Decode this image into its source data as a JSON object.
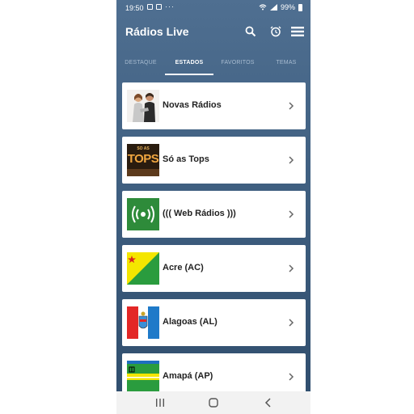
{
  "status": {
    "time": "19:50",
    "dots": "···",
    "battery": "99%"
  },
  "appbar": {
    "title": "Rádios Live"
  },
  "tabs": [
    {
      "label": "DESTAQUE"
    },
    {
      "label": "ESTADOS"
    },
    {
      "label": "FAVORITOS"
    },
    {
      "label": "TEMAS"
    }
  ],
  "items": [
    {
      "label": "Novas Rádios"
    },
    {
      "label": "Só as Tops",
      "thumb_text": "TOPS",
      "thumb_small": "SO AS"
    },
    {
      "label": "((( Web Rádios )))"
    },
    {
      "label": "Acre (AC)"
    },
    {
      "label": "Alagoas (AL)"
    },
    {
      "label": "Amapá (AP)"
    }
  ],
  "colors": {
    "header": "#4f6f91",
    "web_green": "#2e8b3a",
    "acre_yellow": "#f4e600",
    "acre_green": "#2a9c3e"
  }
}
